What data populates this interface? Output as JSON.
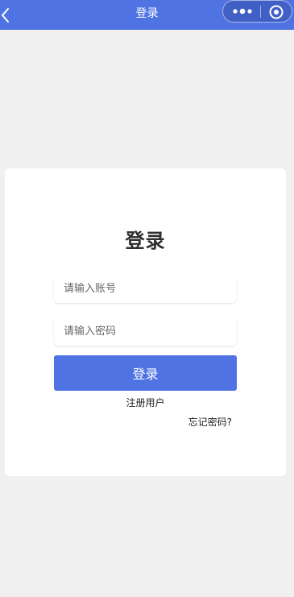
{
  "navbar": {
    "title": "登录",
    "back_icon": "chevron-left-icon",
    "more_icon": "more-dots-icon",
    "close_icon": "target-close-icon",
    "color": "#4f73e3"
  },
  "login": {
    "heading": "登录",
    "account_placeholder": "请输入账号",
    "password_placeholder": "请输入密码",
    "submit_label": "登录",
    "register_label": "注册用户",
    "forgot_label": "忘记密码?"
  },
  "colors": {
    "accent": "#4f73e3",
    "background": "#f0f0f0",
    "card": "#ffffff"
  }
}
